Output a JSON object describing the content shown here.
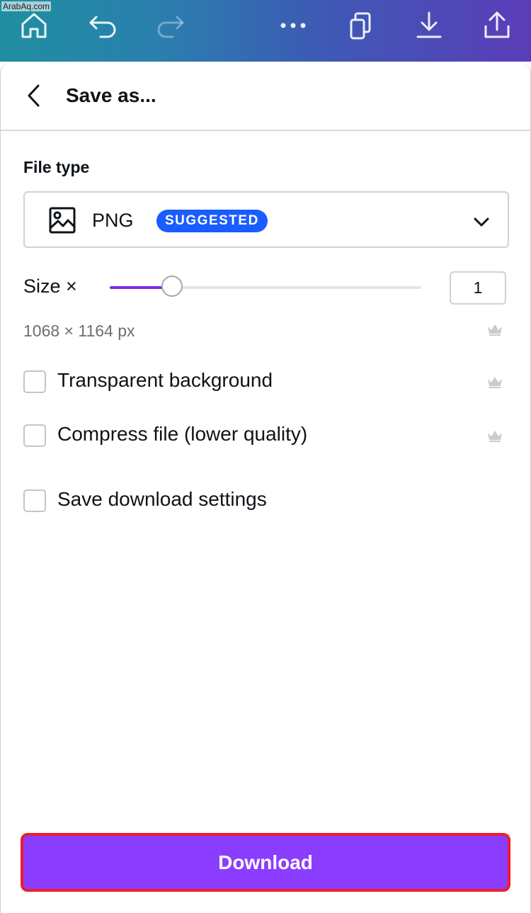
{
  "watermark": "ArabAq.com",
  "topbar": {
    "icons": [
      "home-icon",
      "undo-icon",
      "redo-icon",
      "more-icon",
      "duplicate-icon",
      "download-icon",
      "share-icon"
    ]
  },
  "panel": {
    "title": "Save as...",
    "file_type_label": "File type",
    "file_type": {
      "value": "PNG",
      "badge": "SUGGESTED"
    },
    "size": {
      "label": "Size ×",
      "value": "1",
      "slider_fraction": 0.2
    },
    "dimensions": "1068 × 1164 px",
    "options": [
      {
        "label": "Transparent background",
        "checked": false,
        "premium": true
      },
      {
        "label": "Compress file (lower quality)",
        "checked": false,
        "premium": true
      },
      {
        "label": "Save download settings",
        "checked": false,
        "premium": false
      }
    ],
    "download_label": "Download"
  },
  "colors": {
    "accent": "#7d2ae8",
    "button": "#8b3dff",
    "badge": "#1a5dff",
    "highlight_border": "#ee1d2c"
  }
}
